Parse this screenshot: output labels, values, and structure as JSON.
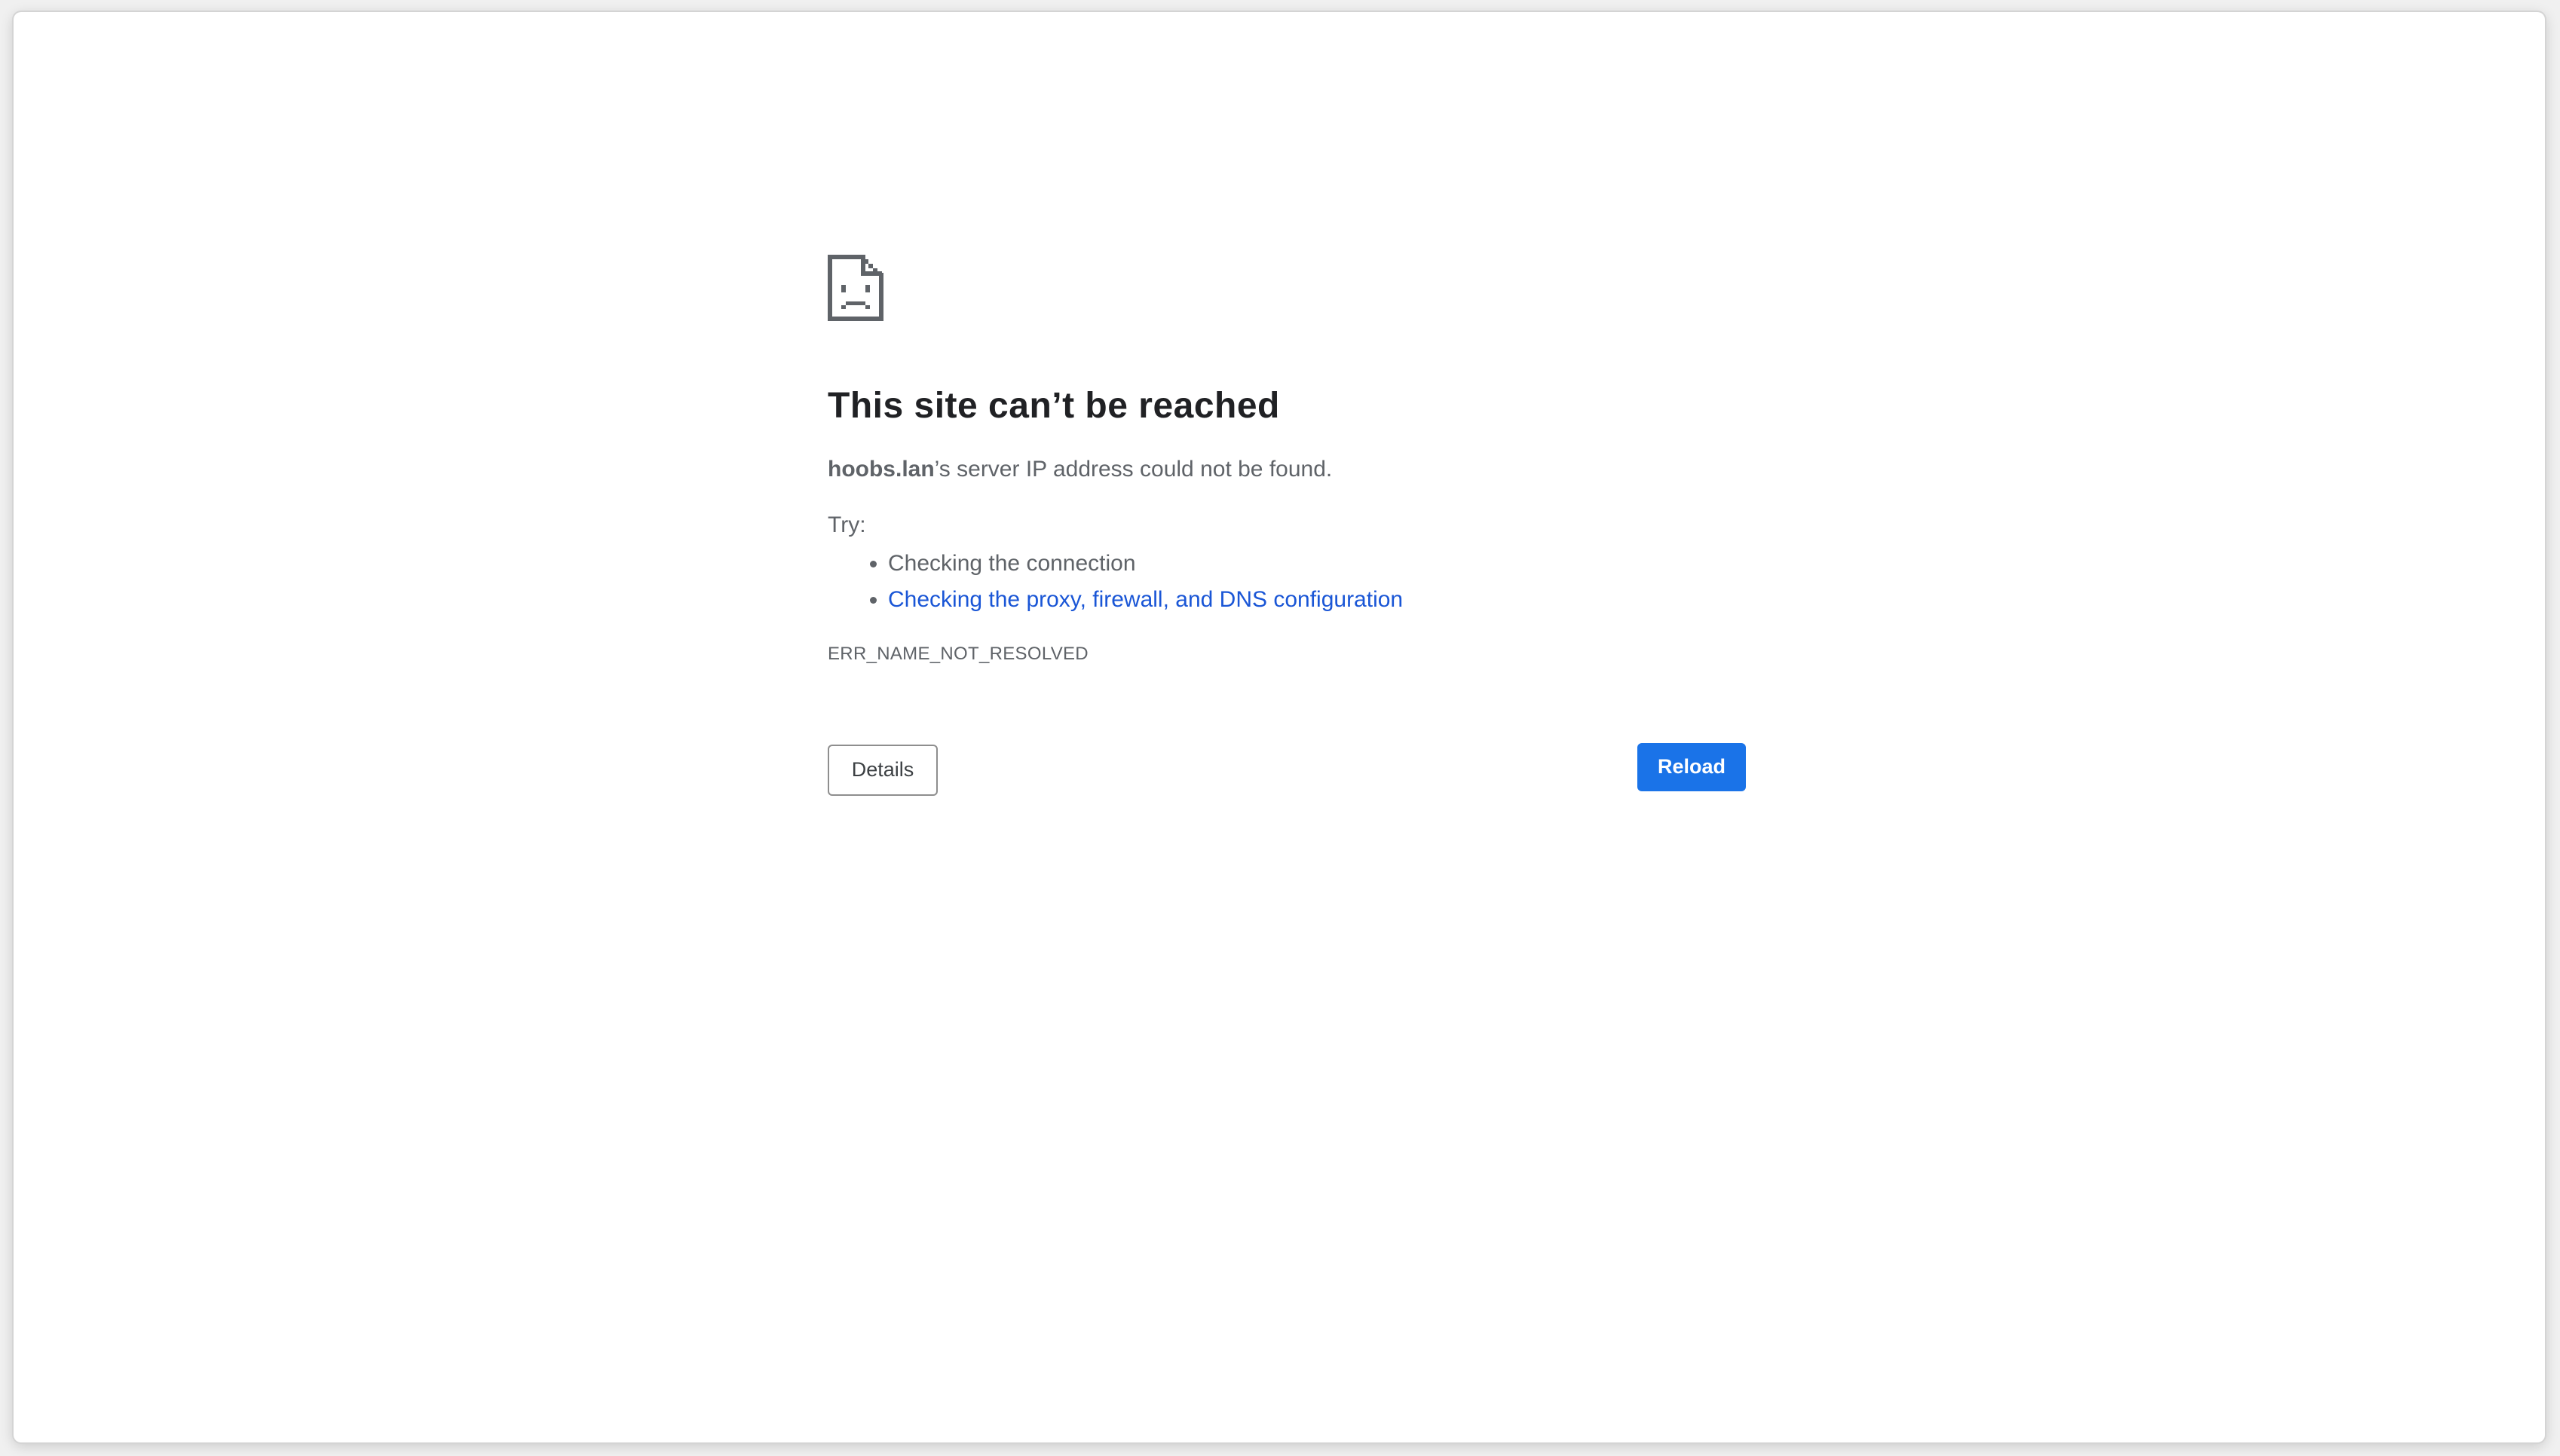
{
  "page": {
    "title": "This site can’t be reached",
    "summary_host": "hoobs.lan",
    "summary_rest": "’s server IP address could not be found.",
    "try_label": "Try:",
    "suggestions": [
      "Checking the connection",
      "Checking the proxy, firewall, and DNS configuration"
    ],
    "error_code": "ERR_NAME_NOT_RESOLVED"
  },
  "buttons": {
    "details_label": "Details",
    "reload_label": "Reload"
  },
  "icons": {
    "main": "sad-page-icon"
  },
  "colors": {
    "accent": "#1a73e8",
    "link": "#1a56d6",
    "text": "#5f6368",
    "heading": "#202124"
  }
}
